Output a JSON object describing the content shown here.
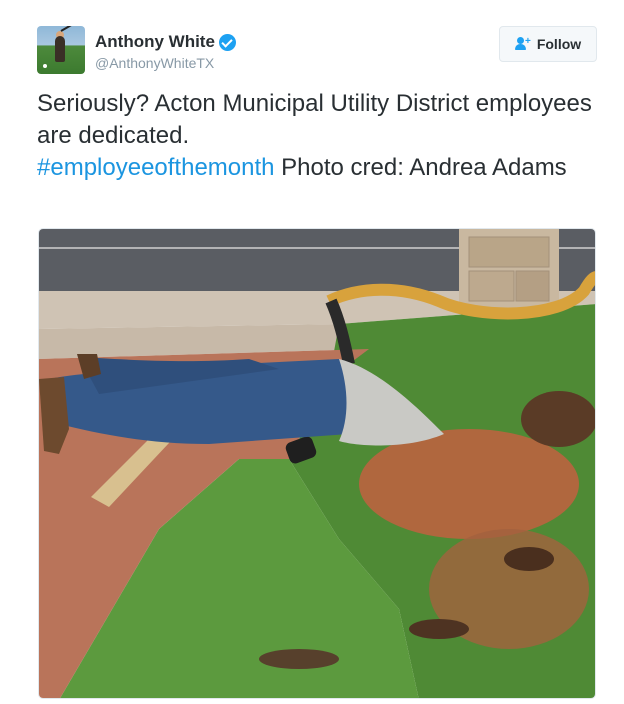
{
  "tweet": {
    "author": {
      "name": "Anthony White",
      "handle": "@AnthonyWhiteTX",
      "verified": true,
      "avatar_icon": "golfer-avatar"
    },
    "follow_button": {
      "label": "Follow",
      "icon": "follow-person-plus-icon"
    },
    "text": {
      "part1": "Seriously?  Acton Municipal Utility District employees are dedicated.",
      "hashtag": "#employeeofthemonth",
      "part2": " Photo cred: Andrea Adams"
    },
    "photo": {
      "icon": "photo-worker-in-hole"
    }
  },
  "colors": {
    "link": "#1b95e0",
    "verified": "#1da1f2",
    "text": "#292f33",
    "handle": "#8899a6"
  }
}
